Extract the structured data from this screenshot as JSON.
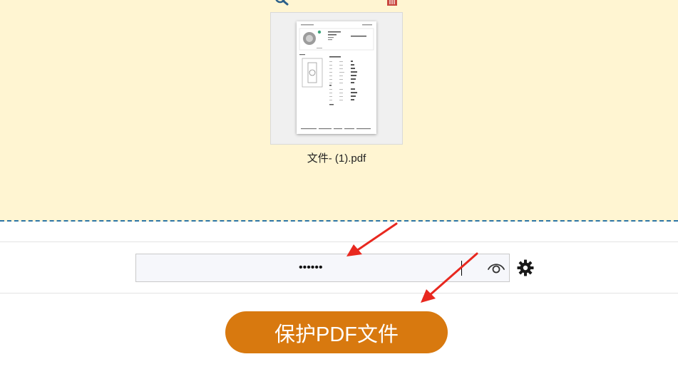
{
  "dropzone": {
    "zoom_icon": "magnifier-icon",
    "delete_icon": "trash-icon",
    "file": {
      "name": "文件- (1).pdf"
    }
  },
  "password": {
    "value": "••••••",
    "toggle_icon": "eye-icon",
    "settings_icon": "gear-icon"
  },
  "actions": {
    "protect_label": "保护PDF文件"
  },
  "colors": {
    "dropzone_bg": "#fff5d2",
    "dashed_border": "#2b74a6",
    "button": "#d8790f",
    "annotation_arrow": "#e8281f"
  }
}
